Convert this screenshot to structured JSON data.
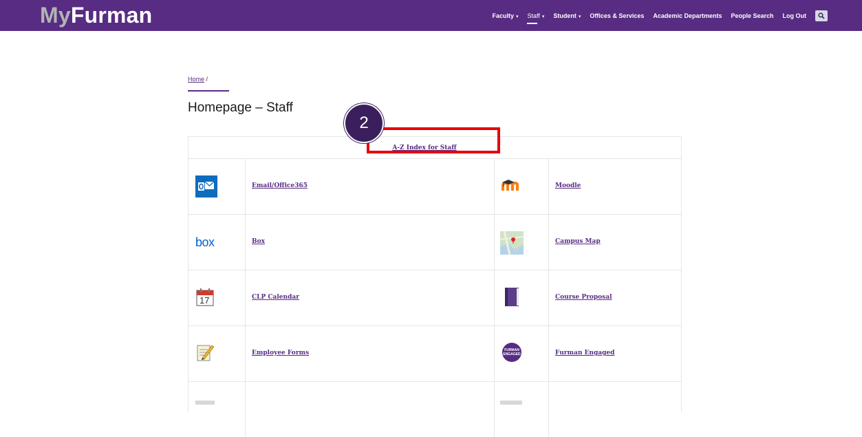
{
  "header": {
    "logo_my": "My",
    "logo_furman": "Furman",
    "nav": [
      {
        "label": "Faculty",
        "caret": "▾"
      },
      {
        "label": "Staff",
        "caret": "▾"
      },
      {
        "label": "Student",
        "caret": "▾"
      },
      {
        "label": "Offices & Services"
      },
      {
        "label": "Academic Departments"
      },
      {
        "label": "People Search"
      },
      {
        "label": "Log Out"
      }
    ]
  },
  "breadcrumb": {
    "home": "Home",
    "separator": "/"
  },
  "page_title": "Homepage – Staff",
  "az_index": "A-Z Index for Staff",
  "links": [
    {
      "left": "Email/Office365",
      "right": "Moodle",
      "left_icon": "outlook-icon",
      "right_icon": "moodle-icon"
    },
    {
      "left": "Box",
      "right": "Campus Map",
      "left_icon": "box-icon",
      "right_icon": "map-icon"
    },
    {
      "left": "CLP Calendar",
      "right": "Course Proposal",
      "left_icon": "calendar-icon",
      "right_icon": "book-icon"
    },
    {
      "left": "Employee Forms",
      "right": "Furman Engaged",
      "left_icon": "forms-icon",
      "right_icon": "furman-engaged-icon"
    }
  ],
  "calendar_day": "17",
  "box_text": "box",
  "engaged_text_1": "FURMAN",
  "engaged_text_2": "ENGAGED",
  "step_badge": "2",
  "colors": {
    "brand": "#582c83",
    "highlight": "#e8000b"
  }
}
